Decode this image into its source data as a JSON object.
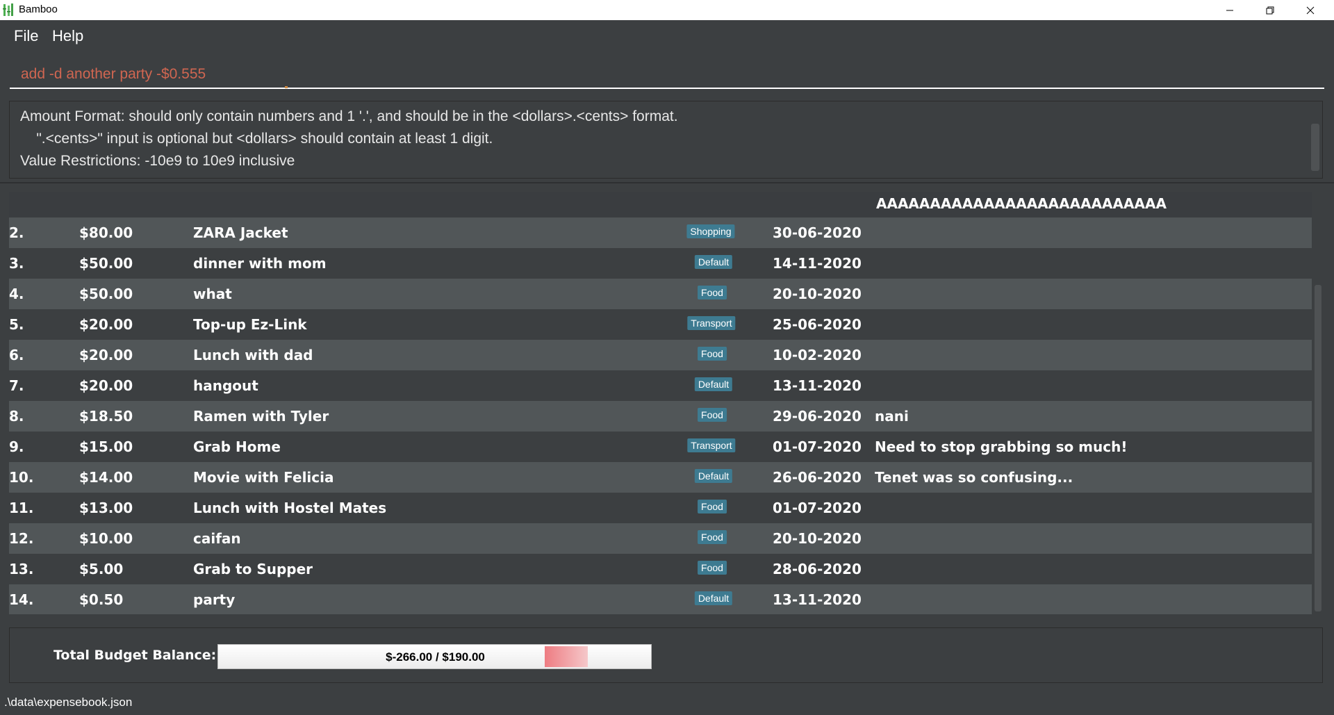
{
  "window": {
    "title": "Bamboo"
  },
  "menu": {
    "file": "File",
    "help": "Help"
  },
  "command": {
    "value": "add -d another party -$0.555"
  },
  "result": {
    "lines": [
      "Amount Format: should only contain numbers and 1 '.', and should be in the <dollars>.<cents> format.",
      "    \".<cents>\" input is optional but <dollars> should contain at least 1 digit.",
      "Value Restrictions: -10e9 to 10e9 inclusive"
    ]
  },
  "list": {
    "header_text": "AAAAAAAAAAAAAAAAAAAAAAAAAAA",
    "rows": [
      {
        "index": "2.",
        "amount": "$80.00",
        "description": "ZARA Jacket",
        "tag": "Shopping",
        "date": "30-06-2020",
        "remark": ""
      },
      {
        "index": "3.",
        "amount": "$50.00",
        "description": "dinner with mom",
        "tag": "Default",
        "date": "14-11-2020",
        "remark": ""
      },
      {
        "index": "4.",
        "amount": "$50.00",
        "description": "what",
        "tag": "Food",
        "date": "20-10-2020",
        "remark": ""
      },
      {
        "index": "5.",
        "amount": "$20.00",
        "description": "Top-up Ez-Link",
        "tag": "Transport",
        "date": "25-06-2020",
        "remark": ""
      },
      {
        "index": "6.",
        "amount": "$20.00",
        "description": "Lunch with dad",
        "tag": "Food",
        "date": "10-02-2020",
        "remark": ""
      },
      {
        "index": "7.",
        "amount": "$20.00",
        "description": "hangout",
        "tag": "Default",
        "date": "13-11-2020",
        "remark": ""
      },
      {
        "index": "8.",
        "amount": "$18.50",
        "description": "Ramen with Tyler",
        "tag": "Food",
        "date": "29-06-2020",
        "remark": "nani"
      },
      {
        "index": "9.",
        "amount": "$15.00",
        "description": "Grab Home",
        "tag": "Transport",
        "date": "01-07-2020",
        "remark": "Need to stop grabbing so much!"
      },
      {
        "index": "10.",
        "amount": "$14.00",
        "description": "Movie with Felicia",
        "tag": "Default",
        "date": "26-06-2020",
        "remark": "Tenet was so confusing..."
      },
      {
        "index": "11.",
        "amount": "$13.00",
        "description": "Lunch with Hostel Mates",
        "tag": "Food",
        "date": "01-07-2020",
        "remark": ""
      },
      {
        "index": "12.",
        "amount": "$10.00",
        "description": "caifan",
        "tag": "Food",
        "date": "20-10-2020",
        "remark": ""
      },
      {
        "index": "13.",
        "amount": "$5.00",
        "description": "Grab to Supper",
        "tag": "Food",
        "date": "28-06-2020",
        "remark": ""
      },
      {
        "index": "14.",
        "amount": "$0.50",
        "description": "party",
        "tag": "Default",
        "date": "13-11-2020",
        "remark": ""
      }
    ]
  },
  "budget": {
    "label": "Total Budget Balance:",
    "value_text": "$-266.00 / $190.00"
  },
  "status": {
    "path": ".\\data\\expensebook.json"
  },
  "colors": {
    "tag_bg": "#3e7b91",
    "error_text": "#d06651",
    "accent": "#ee7c82"
  }
}
